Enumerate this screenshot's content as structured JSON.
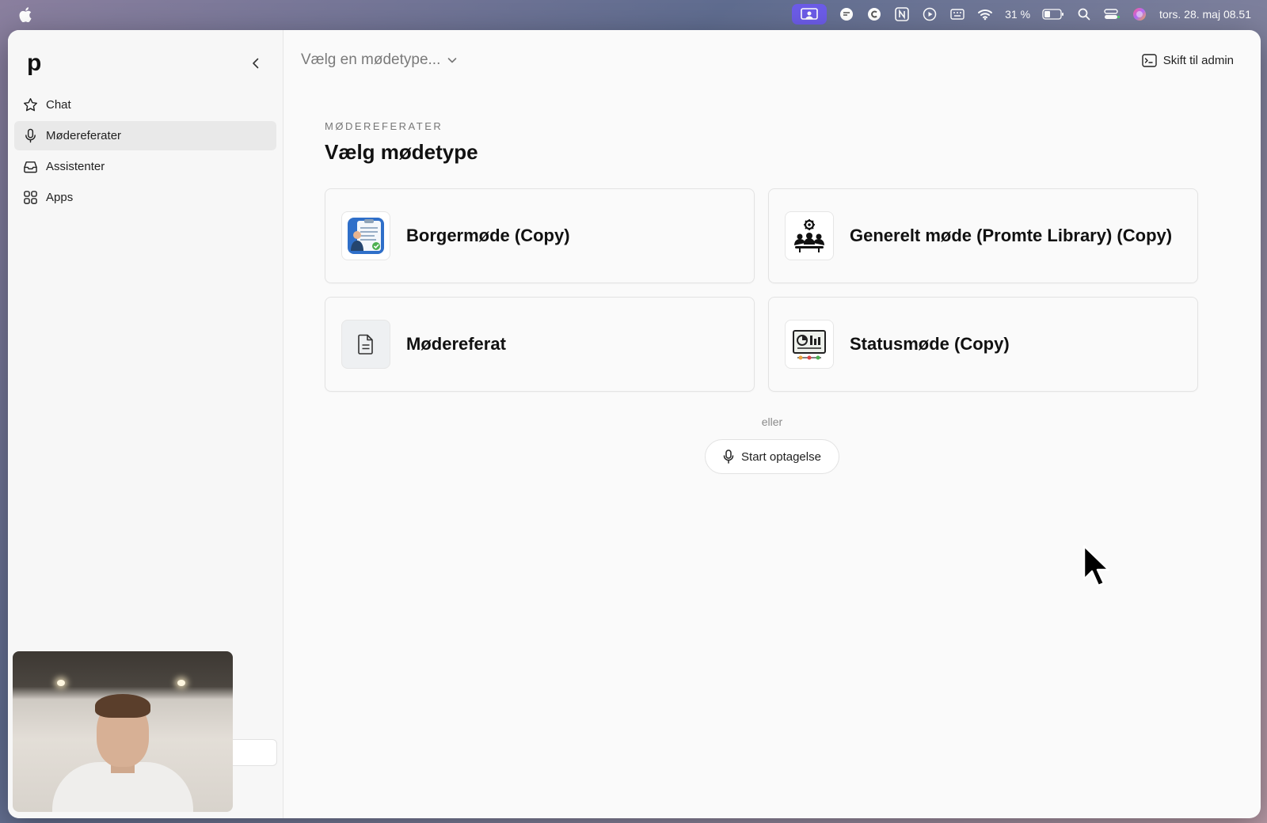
{
  "menubar": {
    "battery": "31 %",
    "datetime": "tors. 28. maj  08.51",
    "icons": [
      "apple-icon",
      "screen-record-icon",
      "chat-bubble-icon",
      "c-app-icon",
      "notion-icon",
      "play-icon",
      "keyboard-icon",
      "wifi-icon",
      "battery-icon",
      "search-icon",
      "control-center-icon",
      "siri-icon"
    ]
  },
  "sidebar": {
    "logo": "p",
    "items": [
      {
        "label": "Chat",
        "icon": "star-icon",
        "active": false
      },
      {
        "label": "Mødereferater",
        "icon": "microphone-icon",
        "active": true
      },
      {
        "label": "Assistenter",
        "icon": "inbox-icon",
        "active": false
      },
      {
        "label": "Apps",
        "icon": "apps-grid-icon",
        "active": false
      }
    ]
  },
  "topbar": {
    "select_placeholder": "Vælg en mødetype...",
    "admin_label": "Skift til admin"
  },
  "main": {
    "eyebrow": "MØDEREFERATER",
    "title": "Vælg mødetype",
    "cards": [
      {
        "title": "Borgermøde (Copy)",
        "icon": "clipboard-person-icon"
      },
      {
        "title": "Generelt møde (Promte Library) (Copy)",
        "icon": "team-gear-icon"
      },
      {
        "title": "Mødereferat",
        "icon": "document-icon"
      },
      {
        "title": "Statusmøde (Copy)",
        "icon": "dashboard-screen-icon"
      }
    ],
    "or_text": "eller",
    "record_label": "Start optagelse"
  },
  "colors": {
    "accent_purple": "#6c5ce7",
    "active_nav_bg": "#e9e9e9",
    "window_bg": "#fafafa"
  }
}
